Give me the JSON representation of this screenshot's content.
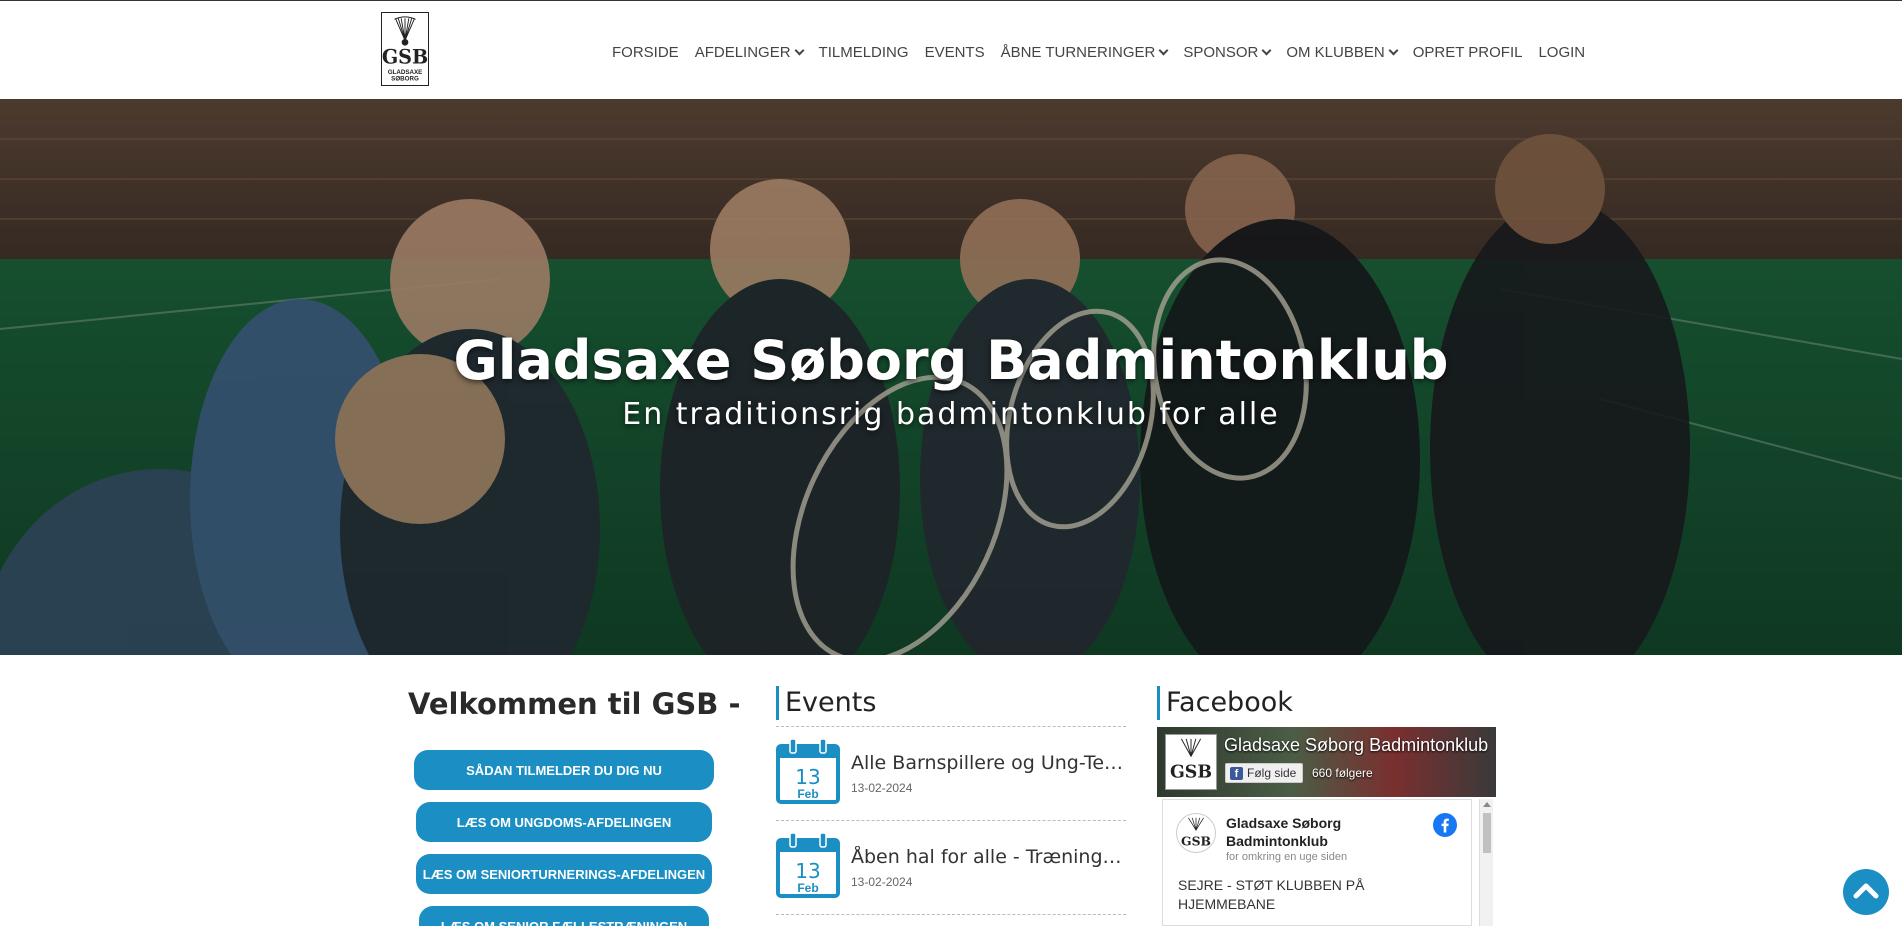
{
  "header": {
    "logo_text": "GSB",
    "logo_sub1": "GLADSAXE",
    "logo_sub2": "SØBORG",
    "nav": [
      {
        "label": "FORSIDE",
        "dropdown": false
      },
      {
        "label": "AFDELINGER",
        "dropdown": true
      },
      {
        "label": "TILMELDING",
        "dropdown": false
      },
      {
        "label": "EVENTS",
        "dropdown": false
      },
      {
        "label": "ÅBNE TURNERINGER",
        "dropdown": true
      },
      {
        "label": "SPONSOR",
        "dropdown": true
      },
      {
        "label": "OM KLUBBEN",
        "dropdown": true
      },
      {
        "label": "OPRET PROFIL",
        "dropdown": false
      },
      {
        "label": "LOGIN",
        "dropdown": false
      }
    ]
  },
  "hero": {
    "title": "Gladsaxe Søborg Badmintonklub",
    "subtitle": "En traditionsrig badmintonklub for alle"
  },
  "welcome": {
    "title": "Velkommen til GSB -",
    "buttons": [
      "SÅDAN TILMELDER DU DIG NU",
      "LÆS OM UNGDOMS-AFDELINGEN",
      "LÆS OM SENIORTURNERINGS-AFDELINGEN",
      "LÆS OM SENIOR FÆLLESTRÆNINGEN"
    ]
  },
  "events": {
    "title": "Events",
    "items": [
      {
        "day": "13",
        "month": "Feb",
        "title": "Alle Barnspillere og Ung-Teenspillere",
        "date": "13-02-2024"
      },
      {
        "day": "13",
        "month": "Feb",
        "title": "Åben hal for alle - Træning i hallen",
        "date": "13-02-2024"
      }
    ]
  },
  "facebook": {
    "title": "Facebook",
    "page_name": "Gladsaxe Søborg Badmintonklub",
    "follow_label": "Følg side",
    "followers": "660 følgere",
    "post_author": "Gladsaxe Søborg Badmintonklub",
    "post_meta": "for omkring en uge siden",
    "post_text": "SEJRE - STØT KLUBBEN PÅ HJEMMEBANE"
  },
  "colors": {
    "accent": "#1b8fc4",
    "nav_text": "#444444",
    "heading": "#2a2a2a"
  },
  "icons": {
    "back_to_top": "chevron-up-icon",
    "calendar": "calendar-icon",
    "facebook": "facebook-icon"
  }
}
